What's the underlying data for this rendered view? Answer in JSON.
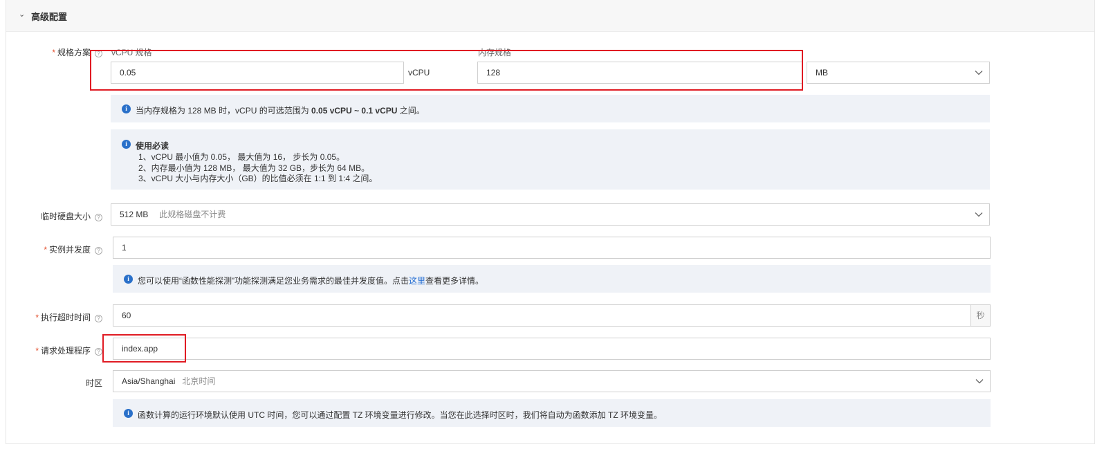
{
  "section": {
    "title": "高级配置"
  },
  "spec": {
    "label": "规格方案",
    "vcpu_label": "vCPU 规格",
    "vcpu_value": "0.05",
    "vcpu_unit": "vCPU",
    "memory_label": "内存规格",
    "memory_value": "128",
    "memory_unit": "MB",
    "range_prefix": "当内存规格为 128 MB 时，vCPU 的可选范围为 ",
    "range_value": "0.05 vCPU ~ 0.1 vCPU",
    "range_suffix": " 之间。",
    "notice_title": "使用必读",
    "notice_lines": [
      "1、vCPU 最小值为 0.05， 最大值为 16， 步长为 0.05。",
      "2、内存最小值为 128 MB， 最大值为 32 GB，步长为 64 MB。",
      "3、vCPU 大小与内存大小（GB）的比值必须在 1:1 到 1:4 之间。"
    ]
  },
  "disk": {
    "label": "临时硬盘大小",
    "value": "512 MB",
    "note": "此规格磁盘不计费"
  },
  "concurrency": {
    "label": "实例并发度",
    "value": "1",
    "tip_prefix": "您可以使用“函数性能探测”功能探测满足您业务需求的最佳并发度值。点击",
    "tip_link": "这里",
    "tip_suffix": "查看更多详情。"
  },
  "timeout": {
    "label": "执行超时时间",
    "value": "60",
    "unit": "秒"
  },
  "handler": {
    "label": "请求处理程序",
    "value": "index.app"
  },
  "timezone": {
    "label": "时区",
    "value": "Asia/Shanghai",
    "note": "北京时间",
    "tip": "函数计算的运行环境默认使用 UTC 时间，您可以通过配置 TZ 环境变量进行修改。当您在此选择时区时，我们将自动为函数添加 TZ 环境变量。"
  },
  "colors": {
    "accent": "#1a67d1",
    "info_bg": "#eff2f7",
    "required": "#e34d2b",
    "highlight": "#e01b23"
  }
}
